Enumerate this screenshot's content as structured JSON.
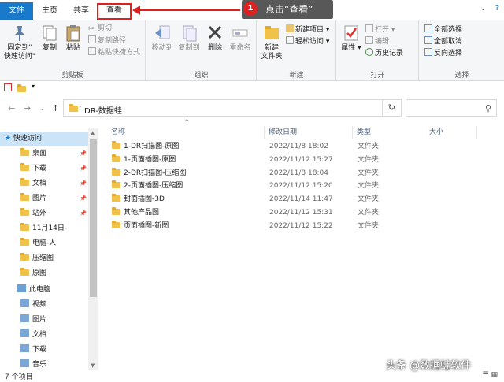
{
  "tabs": {
    "file": "文件",
    "home": "主页",
    "share": "共享",
    "view": "查看"
  },
  "annotation": {
    "number": "1",
    "text": "点击“查看”"
  },
  "ribbon": {
    "clipboard": {
      "label": "剪贴板",
      "pin": "固定到\"\n快速访问\"",
      "pin_l1": "固定到\"",
      "pin_l2": "快速访问\"",
      "copy": "复制",
      "paste": "粘贴",
      "cut": "剪切",
      "copy_path": "复制路径",
      "paste_shortcut": "粘贴快捷方式"
    },
    "organize": {
      "label": "组织",
      "move_to": "移动到",
      "copy_to": "复制到",
      "delete": "删除",
      "rename": "重命名"
    },
    "new": {
      "label": "新建",
      "new_folder_l1": "新建",
      "new_folder_l2": "文件夹",
      "new_item": "新建项目",
      "easy_access": "轻松访问"
    },
    "open": {
      "label": "打开",
      "properties": "属性",
      "open": "打开",
      "edit": "编辑",
      "history": "历史记录"
    },
    "select": {
      "label": "选择",
      "select_all": "全部选择",
      "select_none": "全部取消",
      "invert": "反向选择"
    }
  },
  "address": {
    "path": "DR-数据蛙"
  },
  "columns": {
    "name": "名称",
    "date": "修改日期",
    "type": "类型",
    "size": "大小"
  },
  "files": [
    {
      "name": "1-DR扫描图-原图",
      "date": "2022/11/8 18:02",
      "type": "文件夹"
    },
    {
      "name": "1-页面插图-原图",
      "date": "2022/11/12 15:27",
      "type": "文件夹"
    },
    {
      "name": "2-DR扫描图-压缩图",
      "date": "2022/11/8 18:04",
      "type": "文件夹"
    },
    {
      "name": "2-页面插图-压缩图",
      "date": "2022/11/12 15:20",
      "type": "文件夹"
    },
    {
      "name": "封面插图-3D",
      "date": "2022/11/14 11:47",
      "type": "文件夹"
    },
    {
      "name": "其他产品图",
      "date": "2022/11/12 15:31",
      "type": "文件夹"
    },
    {
      "name": "页面插图-新图",
      "date": "2022/11/12 15:22",
      "type": "文件夹"
    }
  ],
  "nav": {
    "quick_access": "快速访问",
    "items": [
      "桌面",
      "下载",
      "文档",
      "图片",
      "站外",
      "11月14日-",
      "电脑-人",
      "压缩图",
      "原图"
    ],
    "this_pc": "此电脑",
    "pc_items": [
      "视频",
      "图片",
      "文档",
      "下载",
      "音乐"
    ]
  },
  "status": {
    "count": "7 个项目"
  },
  "watermark": "头条 @数据蛙软件",
  "colors": {
    "accent": "#1979ca",
    "annotation": "#e02020",
    "folder": "#f0c24a"
  }
}
